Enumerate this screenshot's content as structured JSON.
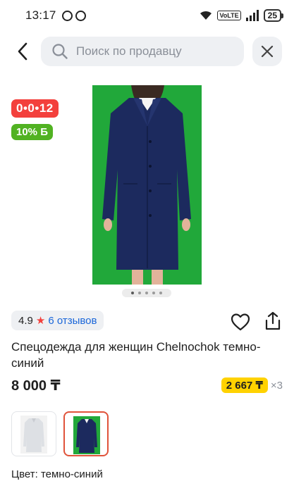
{
  "status": {
    "time": "13:17",
    "network": "VoLTE",
    "battery": "25"
  },
  "search": {
    "placeholder": "Поиск по продавцу"
  },
  "badges": {
    "timer": "0•0•12",
    "bonus": "10% Б"
  },
  "gallery": {
    "image_count": 5,
    "active_index": 0
  },
  "rating": {
    "value": "4.9",
    "reviews": "6 отзывов"
  },
  "product": {
    "title": "Спецодежда для женщин Chelnochok темно-синий",
    "price": "8 000 ₸",
    "installment_amount": "2 667 ₸",
    "installment_times": "×3",
    "color_label": "Цвет: темно-синий"
  },
  "variants": [
    {
      "color": "light-grey",
      "selected": false
    },
    {
      "color": "dark-blue",
      "selected": true
    }
  ],
  "colors": {
    "timer_bg": "#f3403c",
    "bonus_bg": "#51b222",
    "link": "#1a66d9",
    "installment_bg": "#ffd200",
    "selected_border": "#e0533a",
    "product_bg": "#21a83a",
    "garment": "#1c2a5e"
  }
}
